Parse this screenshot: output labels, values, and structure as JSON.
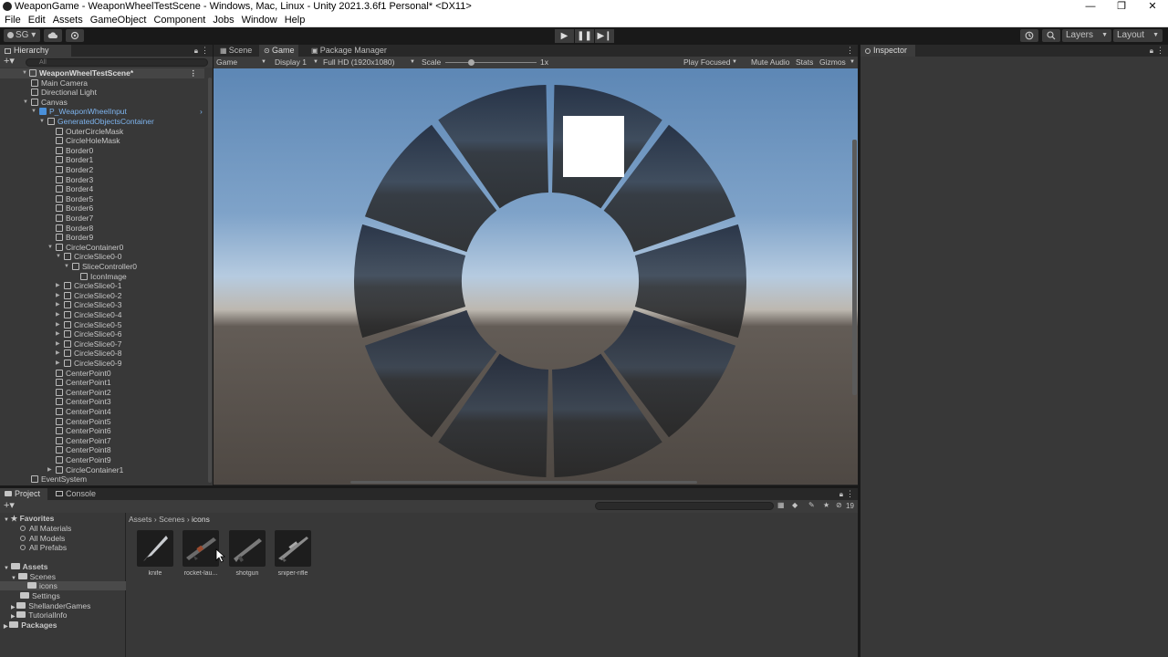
{
  "window": {
    "title": "WeaponGame - WeaponWheelTestScene - Windows, Mac, Linux - Unity 2021.3.6f1 Personal* <DX11>",
    "controls": [
      "—",
      "❐",
      "✕"
    ]
  },
  "menu": [
    "File",
    "Edit",
    "Assets",
    "GameObject",
    "Component",
    "Jobs",
    "Window",
    "Help"
  ],
  "toolbar": {
    "account": "SG ▾",
    "layers": "Layers",
    "layout": "Layout",
    "play_icons": [
      "▶",
      "❚❚",
      "▶❙"
    ]
  },
  "hierarchy": {
    "tab": "Hierarchy",
    "search_placeholder": "All",
    "rows": [
      "WeaponWheelTestScene*",
      "Main Camera",
      "Directional Light",
      "Canvas",
      "P_WeaponWheelInput",
      "GeneratedObjectsContainer",
      "OuterCircleMask",
      "CircleHoleMask",
      "Border0",
      "Border1",
      "Border2",
      "Border3",
      "Border4",
      "Border5",
      "Border6",
      "Border7",
      "Border8",
      "Border9",
      "CircleContainer0",
      "CircleSlice0-0",
      "SliceController0",
      "IconImage",
      "CircleSlice0-1",
      "CircleSlice0-2",
      "CircleSlice0-3",
      "CircleSlice0-4",
      "CircleSlice0-5",
      "CircleSlice0-6",
      "CircleSlice0-7",
      "CircleSlice0-8",
      "CircleSlice0-9",
      "CenterPoint0",
      "CenterPoint1",
      "CenterPoint2",
      "CenterPoint3",
      "CenterPoint4",
      "CenterPoint5",
      "CenterPoint6",
      "CenterPoint7",
      "CenterPoint8",
      "CenterPoint9",
      "CircleContainer1",
      "EventSystem"
    ]
  },
  "game": {
    "tabs": [
      "Scene",
      "Game",
      "Package Manager"
    ],
    "display_mode": "Game",
    "display": "Display 1",
    "resolution": "Full HD (1920x1080)",
    "scale_label": "Scale",
    "scale_value": "1x",
    "play_focused": "Play Focused",
    "mute_audio": "Mute Audio",
    "stats": "Stats",
    "gizmos": "Gizmos",
    "wheel_slices": 10
  },
  "inspector": {
    "tab": "Inspector"
  },
  "project": {
    "tabs": [
      "Project",
      "Console"
    ],
    "hidden_count": "19",
    "breadcrumb": [
      "Assets",
      "Scenes",
      "icons"
    ],
    "favorites": "Favorites",
    "favorite_items": [
      "All Materials",
      "All Models",
      "All Prefabs"
    ],
    "assets_root": "Assets",
    "folders": [
      "Scenes",
      "icons",
      "Settings",
      "ShellanderGames",
      "TutorialInfo"
    ],
    "packages": "Packages",
    "assets": [
      "knife",
      "rocket-lau...",
      "shotgun",
      "sniper-rifle"
    ]
  }
}
